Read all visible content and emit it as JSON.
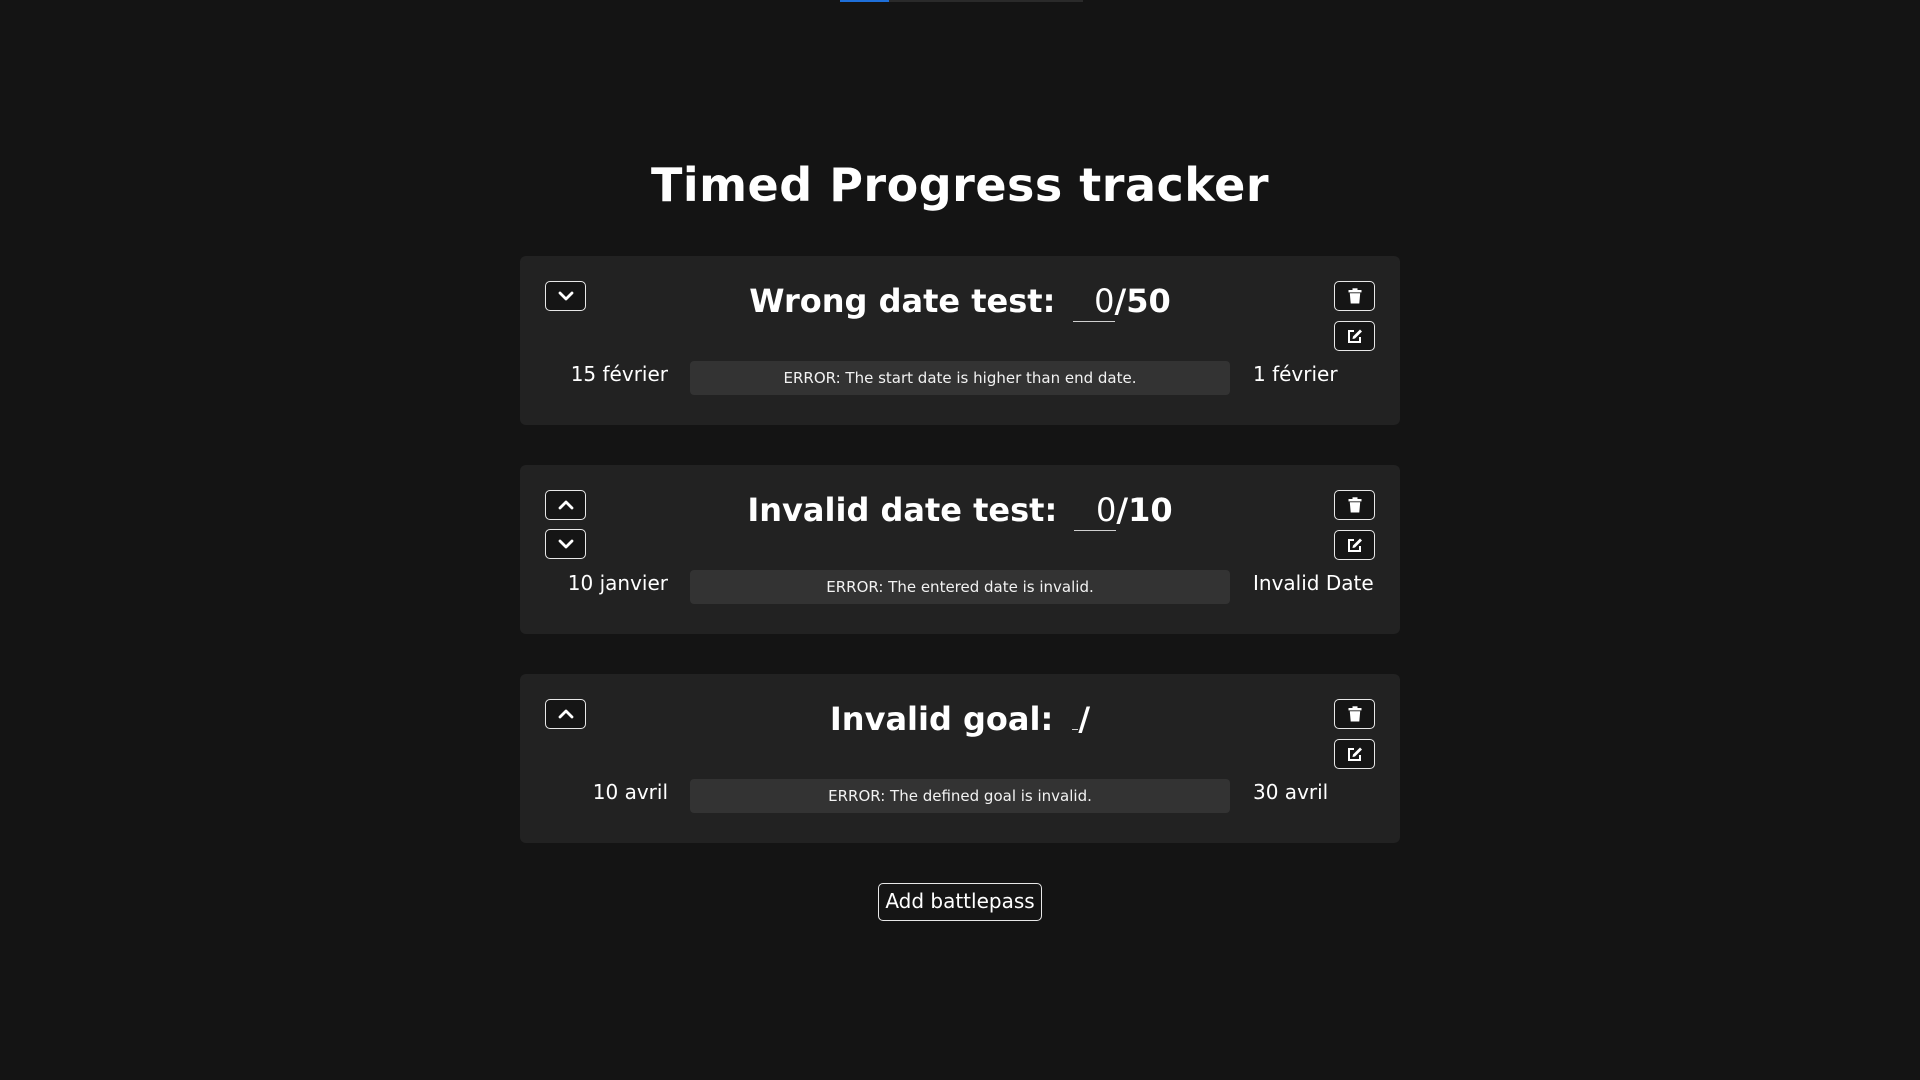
{
  "page": {
    "title": "Timed Progress tracker",
    "add_button_label": "Add battlepass"
  },
  "trackers": [
    {
      "name": "Wrong date test:",
      "progress": "0",
      "goal": "/50",
      "start_date": "15 février",
      "end_date": "1 février",
      "bar_message": "ERROR: The start date is higher than end date.",
      "controls": [
        "move-down"
      ]
    },
    {
      "name": "Invalid date test:",
      "progress": "0",
      "goal": "/10",
      "start_date": "10 janvier",
      "end_date": "Invalid Date",
      "bar_message": "ERROR: The entered date is invalid.",
      "controls": [
        "move-up",
        "move-down"
      ]
    },
    {
      "name": "Invalid goal:",
      "progress": "",
      "goal": "/",
      "start_date": "10 avril",
      "end_date": "30 avril",
      "bar_message": "ERROR: The defined goal is invalid.",
      "controls": [
        "move-up"
      ]
    }
  ],
  "colors": {
    "background": "#141414",
    "card": "#222222",
    "bar": "#333333",
    "accent": "#1e6fd9"
  },
  "icons": [
    "chevron-up-icon",
    "chevron-down-icon",
    "trash-icon",
    "edit-icon"
  ]
}
